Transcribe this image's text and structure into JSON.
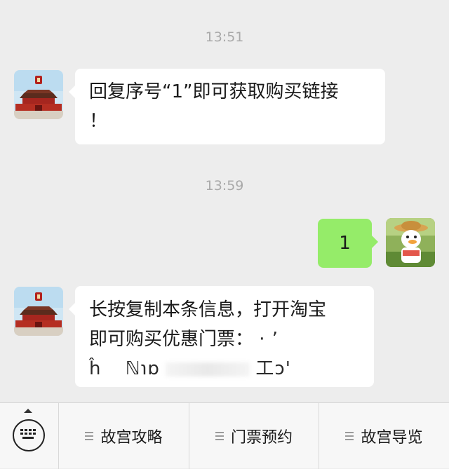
{
  "messages": {
    "time1": "13:51",
    "time2": "13:59",
    "msg1_line1": "回复序号“1”即可获取购买链接",
    "msg1_line2": "！",
    "reply": "1",
    "msg3_line1": "长按复制本条信息，打开淘宝",
    "msg3_line2": "即可购买优惠门票：",
    "msg3_line2_tail": "·  ’",
    "msg3_line3_a": "ĥ",
    "msg3_line3_b": "ℕ℩ɒ",
    "msg3_line3_c": "工ɔ'"
  },
  "menu": {
    "item1": "故宫攻略",
    "item2": "门票预约",
    "item3": "故宫导览"
  },
  "icons": {
    "keyboard": "keyboard-icon",
    "menu": "hamburger-icon",
    "official_avatar": "palace-museum-avatar",
    "user_avatar": "cartoon-duck-avatar"
  },
  "colors": {
    "background": "#ededed",
    "sent_bubble": "#95ec69",
    "received_bubble": "#ffffff"
  }
}
